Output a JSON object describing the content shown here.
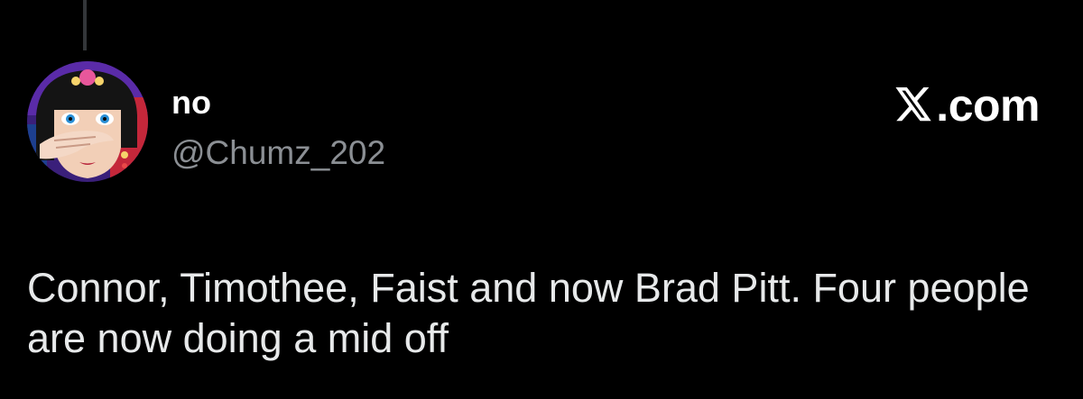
{
  "author": {
    "display_name": "no",
    "handle": "@Chumz_202"
  },
  "brand": {
    "text": ".com",
    "logo_icon": "x-logo-icon"
  },
  "tweet": {
    "text": "Connor, Timothee, Faist and now Brad Pitt. Four people are now doing a mid off"
  },
  "colors": {
    "background": "#000000",
    "name": "#ffffff",
    "handle": "#8b8f94",
    "body": "#e7e9ea",
    "thread_line": "#333639"
  }
}
